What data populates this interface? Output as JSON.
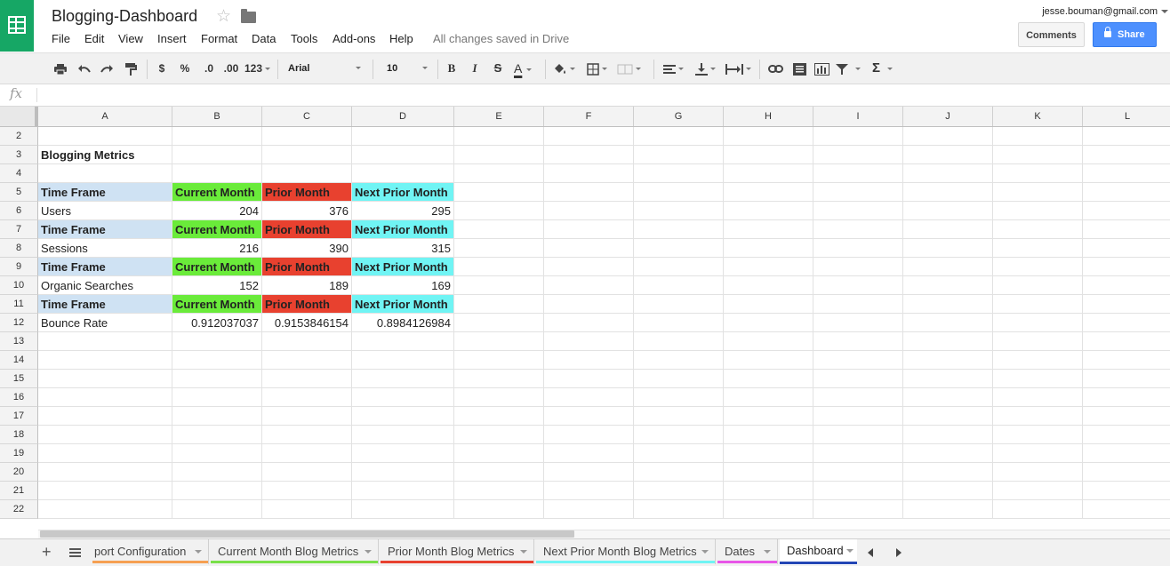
{
  "app": {
    "doc_title": "Blogging-Dashboard",
    "save_status": "All changes saved in Drive",
    "user_email": "jesse.bouman@gmail.com"
  },
  "menu": [
    "File",
    "Edit",
    "View",
    "Insert",
    "Format",
    "Data",
    "Tools",
    "Add-ons",
    "Help"
  ],
  "header_buttons": {
    "comments": "Comments",
    "share": "Share"
  },
  "toolbar": {
    "currency": "$",
    "percent": "%",
    "decrease_decimal": ".0",
    "increase_decimal": ".00",
    "more_formats": "123",
    "font": "Arial",
    "font_size": "10",
    "bold": "B",
    "italic": "I",
    "strike": "S",
    "text_color": "A",
    "sum": "Σ"
  },
  "formula_bar": {
    "fx": "fx",
    "value": ""
  },
  "columns": [
    "A",
    "B",
    "C",
    "D",
    "E",
    "F",
    "G",
    "H",
    "I",
    "J",
    "K",
    "L"
  ],
  "rows": [
    "2",
    "3",
    "4",
    "5",
    "6",
    "7",
    "8",
    "9",
    "10",
    "11",
    "12",
    "13",
    "14",
    "15",
    "16",
    "17",
    "18",
    "19",
    "20",
    "21",
    "22"
  ],
  "cells": {
    "title": "Blogging Metrics",
    "headers": [
      "Time Frame",
      "Current Month",
      "Prior Month",
      "Next Prior Month"
    ],
    "metrics": [
      {
        "name": "Users",
        "current": "204",
        "prior": "376",
        "next_prior": "295"
      },
      {
        "name": "Sessions",
        "current": "216",
        "prior": "390",
        "next_prior": "315"
      },
      {
        "name": "Organic Searches",
        "current": "152",
        "prior": "189",
        "next_prior": "169"
      },
      {
        "name": "Bounce Rate",
        "current": "0.912037037",
        "prior": "0.9153846154",
        "next_prior": "0.8984126984"
      }
    ]
  },
  "colors": {
    "header_a": "#cfe2f3",
    "header_b": "#6aeb3a",
    "header_c": "#e8412f",
    "header_d": "#70f4f4",
    "share": "#4d90fe",
    "brand": "#16a765"
  },
  "sheets": [
    {
      "name": "port Configuration",
      "color": "#f6a052"
    },
    {
      "name": "Current Month Blog Metrics",
      "color": "#79e04a"
    },
    {
      "name": "Prior Month Blog Metrics",
      "color": "#e8412f"
    },
    {
      "name": "Next Prior Month Blog Metrics",
      "color": "#70f4f4"
    },
    {
      "name": "Dates",
      "color": "#e856e8"
    },
    {
      "name": "Dashboard",
      "color": "#2346b5",
      "active": true
    }
  ]
}
